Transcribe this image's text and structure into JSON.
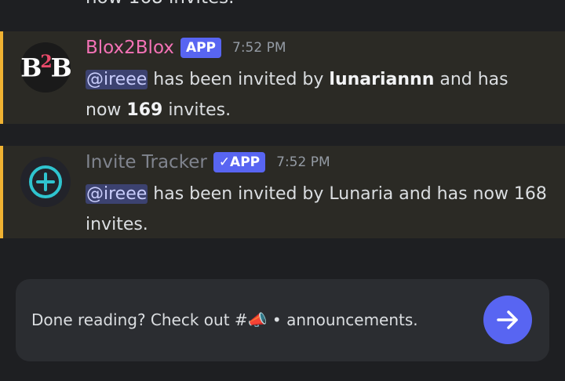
{
  "cutoff_text": "now 168 invites.",
  "messages": [
    {
      "username": "Blox2Blox",
      "tag": "APP",
      "time": "7:52 PM",
      "mention": "@ireee",
      "text_a": " has been invited by ",
      "inviter": "lunariannn",
      "text_b": " and has now ",
      "count": "169",
      "text_c": " invites.",
      "avatar": "b2b-logo"
    },
    {
      "username": "Invite Tracker",
      "tag": "✓APP",
      "time": "7:52 PM",
      "mention": "@ireee",
      "text": " has been invited by Lunaria and has now 168 invites.",
      "avatar": "plus-circle-icon"
    }
  ],
  "banner": {
    "text": "Done reading? Check out #📣 • announcements.",
    "button_icon": "arrow-right-icon"
  },
  "colors": {
    "accent": "#5865f2",
    "highlight_border": "#f0b232",
    "blox2blox_name": "#f472b6"
  }
}
